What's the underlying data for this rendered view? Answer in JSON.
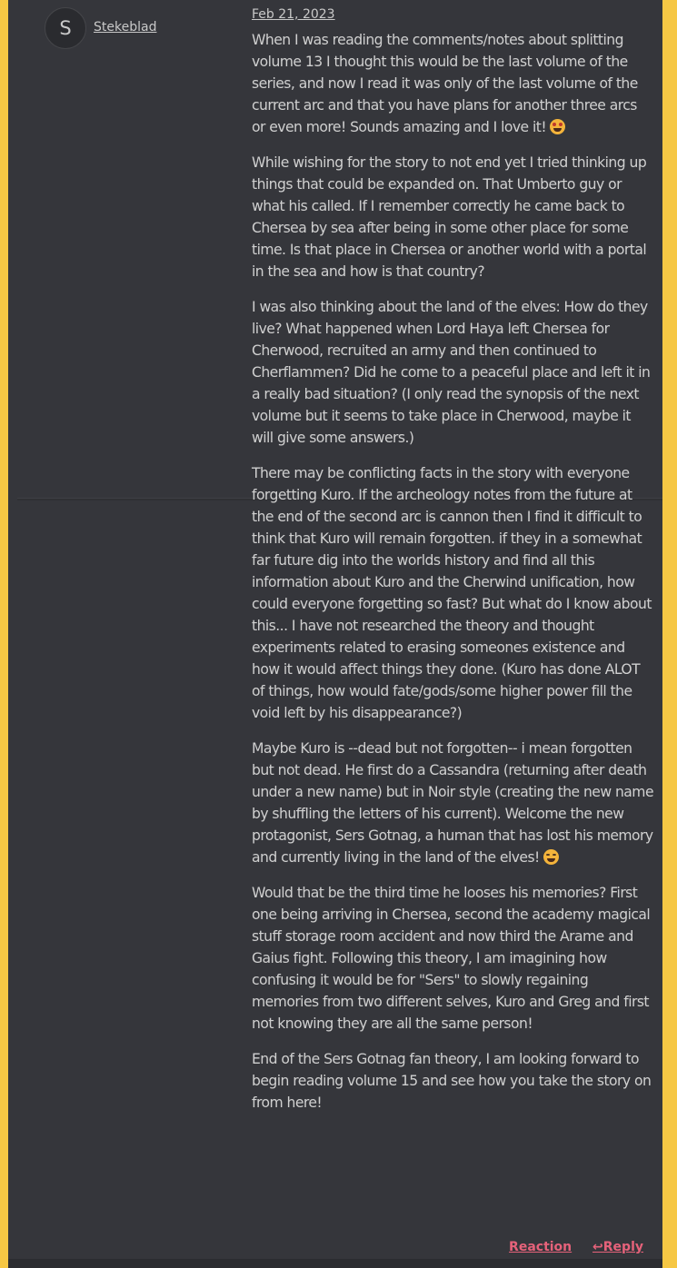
{
  "post": {
    "author_initial": "S",
    "author": "Stekeblad",
    "date": "Feb 21, 2023",
    "paragraphs": [
      "When I was reading the comments/notes about splitting volume 13 I thought this would be the last volume of the series, and now I read it was only of the last volume of the current arc and that you have plans for another three arcs or even more! Sounds amazing and I love it!",
      "While wishing for the story to not end yet I tried thinking up things that could be expanded on. That Umberto guy or what his called. If I remember correctly he came back to Chersea by sea after being in some other place for some time. Is that place in Chersea or another world with a portal in the sea and how is that country?",
      "I was also thinking about the land of the elves: How do they live? What happened when Lord Haya left Chersea for Cherwood, recruited an army and then continued to Cherflammen? Did he come to a peaceful place and left it in a really bad situation? (I only read the synopsis of the next volume but it seems to take place in Cherwood, maybe it will give some answers.)",
      "There may be conflicting facts in the story with everyone forgetting Kuro. If the archeology notes from the future at the end of the second arc is cannon then I find it difficult to think that Kuro will remain forgotten. if they in a somewhat far future dig into the worlds history and find all this information about Kuro and the Cherwind unification, how could everyone forgetting so fast? But what do I know about this... I have not researched the theory and thought experiments related to erasing someones existence and how it would affect things they done. (Kuro has done ALOT of things, how would fate/gods/some higher power fill the void left by his disappearance?)",
      "Maybe Kuro is --dead but not forgotten-- i mean forgotten but not dead. He first do a Cassandra (returning after death under a new name) but in Noir style (creating the new name by shuffling the letters of his current). Welcome the new protagonist, Sers Gotnag, a human that has lost his memory and currently living in the land of the elves!",
      "Would that be the third time he looses his memories? First one being arriving in Chersea, second the academy magical stuff storage room accident and now third the Arame and Gaius fight. Following this theory, I am imagining how confusing it would be for \"Sers\" to slowly regaining memories from two different selves, Kuro and Greg and first not knowing they are all the same person!",
      "End of the Sers Gotnag fan theory, I am looking forward to begin reading volume 15 and see how you take the story on from here!"
    ],
    "emoji_p1": "star-struck-emoji",
    "emoji_p5": "grinning-squinting-emoji"
  },
  "actions": {
    "reaction_label": "Reaction",
    "reply_label": "Reply",
    "reply_icon": "reply-arrow-icon"
  },
  "colors": {
    "accent": "#f6c744",
    "panel": "#35363b",
    "link": "#e6627a"
  }
}
